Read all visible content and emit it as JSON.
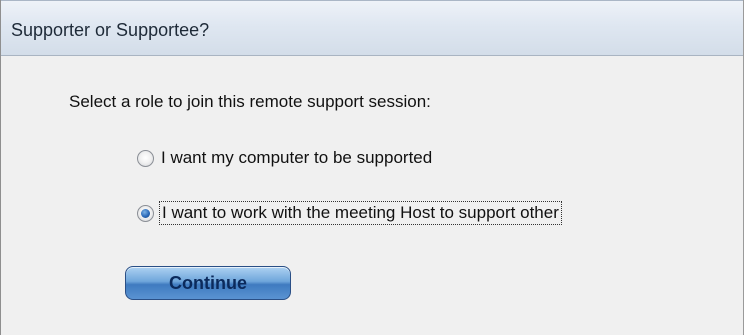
{
  "window": {
    "title": "Supporter or Supportee?"
  },
  "dialog": {
    "prompt": "Select a role to join this remote support session:",
    "options": [
      {
        "label": "I want my computer to be supported",
        "selected": false
      },
      {
        "label": "I want to work with the meeting Host to support other",
        "selected": true
      }
    ],
    "continue_label": "Continue"
  },
  "colors": {
    "accent": "#3f7bc0",
    "titlebar": "#dfe7f1",
    "background": "#f0f0f0"
  },
  "icons": {
    "radio_unselected": "radio-unselected-icon",
    "radio_selected": "radio-selected-icon"
  }
}
